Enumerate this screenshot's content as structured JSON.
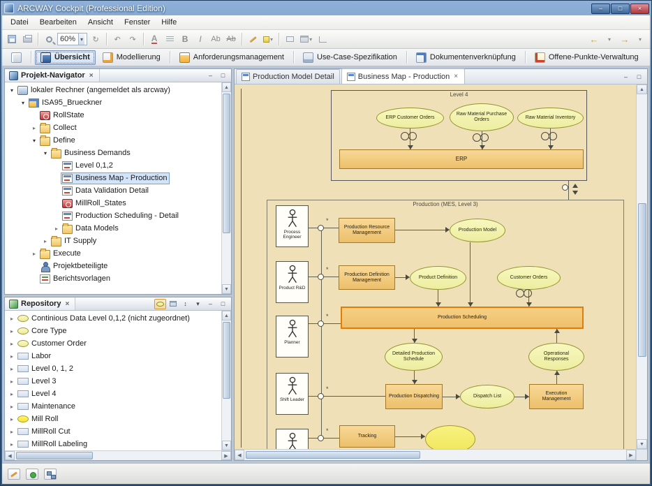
{
  "window": {
    "title": "ARCWAY Cockpit (Professional Edition)"
  },
  "glyphs": {
    "minimize": "–",
    "maximize": "□",
    "close": "×",
    "caret": "▾",
    "collapsed": "▸",
    "expanded": "▾",
    "up": "▲",
    "down": "▼",
    "left": "◀",
    "right": "▶",
    "undo": "↶",
    "redo": "↷",
    "refresh": "↻",
    "back": "←",
    "forward": "→",
    "asterisk": "*",
    "sort": "↕"
  },
  "menu": {
    "items": [
      "Datei",
      "Bearbeiten",
      "Ansicht",
      "Fenster",
      "Hilfe"
    ]
  },
  "toolbar": {
    "zoom_value": "60%",
    "font_color": "A",
    "bold": "B",
    "italic": "I",
    "font_face": "Ab",
    "strike": "Ab"
  },
  "perspectives": {
    "items": [
      "Übersicht",
      "Modellierung",
      "Anforderungsmanagement",
      "Use-Case-Spezifikation",
      "Dokumentenverknüpfung",
      "Offene-Punkte-Verwaltung"
    ]
  },
  "navigator": {
    "title": "Projekt-Navigator",
    "items": [
      "lokaler Rechner (angemeldet als arcway)",
      "ISA95_Brueckner",
      "RollState",
      "Collect",
      "Define",
      "Business Demands",
      "Level 0,1,2",
      "Business Map - Production",
      "Data Validation Detail",
      "MillRoll_States",
      "Production Scheduling - Detail",
      "Data Models",
      "IT Supply",
      "Execute",
      "Projektbeteiligte",
      "Berichtsvorlagen"
    ]
  },
  "repository": {
    "title": "Repository",
    "items": [
      "Continious Data Level 0,1,2 (nicht zugeordnet)",
      "Core Type",
      "Customer Order",
      "Labor",
      "Level 0, 1, 2",
      "Level 3",
      "Level 4",
      "Maintenance",
      "Mill Roll",
      "MillRoll Cut",
      "MillRoll Labeling"
    ]
  },
  "editor": {
    "tabs": [
      "Production Model Detail",
      "Business Map - Production"
    ],
    "diagram": {
      "level4": {
        "label": "Level 4",
        "erp": "ERP",
        "ellipses": [
          "ERP Customer Orders",
          "Raw Material Purchase Orders",
          "Raw Material Inventory"
        ]
      },
      "production": {
        "label": "Production (MES, Level 3)",
        "actors": [
          "Process Engineer",
          "Product R&D",
          "Planner",
          "Shift Leader"
        ],
        "rects": [
          "Production Resource Management",
          "Production Definition Management",
          "Production Scheduling",
          "Production Dispatching",
          "Execution Management",
          "Tracking"
        ],
        "ellipses": [
          "Production Model",
          "Product Definition",
          "Customer Orders",
          "Detailed Production Schedule",
          "Operational Responses",
          "Dispatch List"
        ]
      }
    }
  }
}
